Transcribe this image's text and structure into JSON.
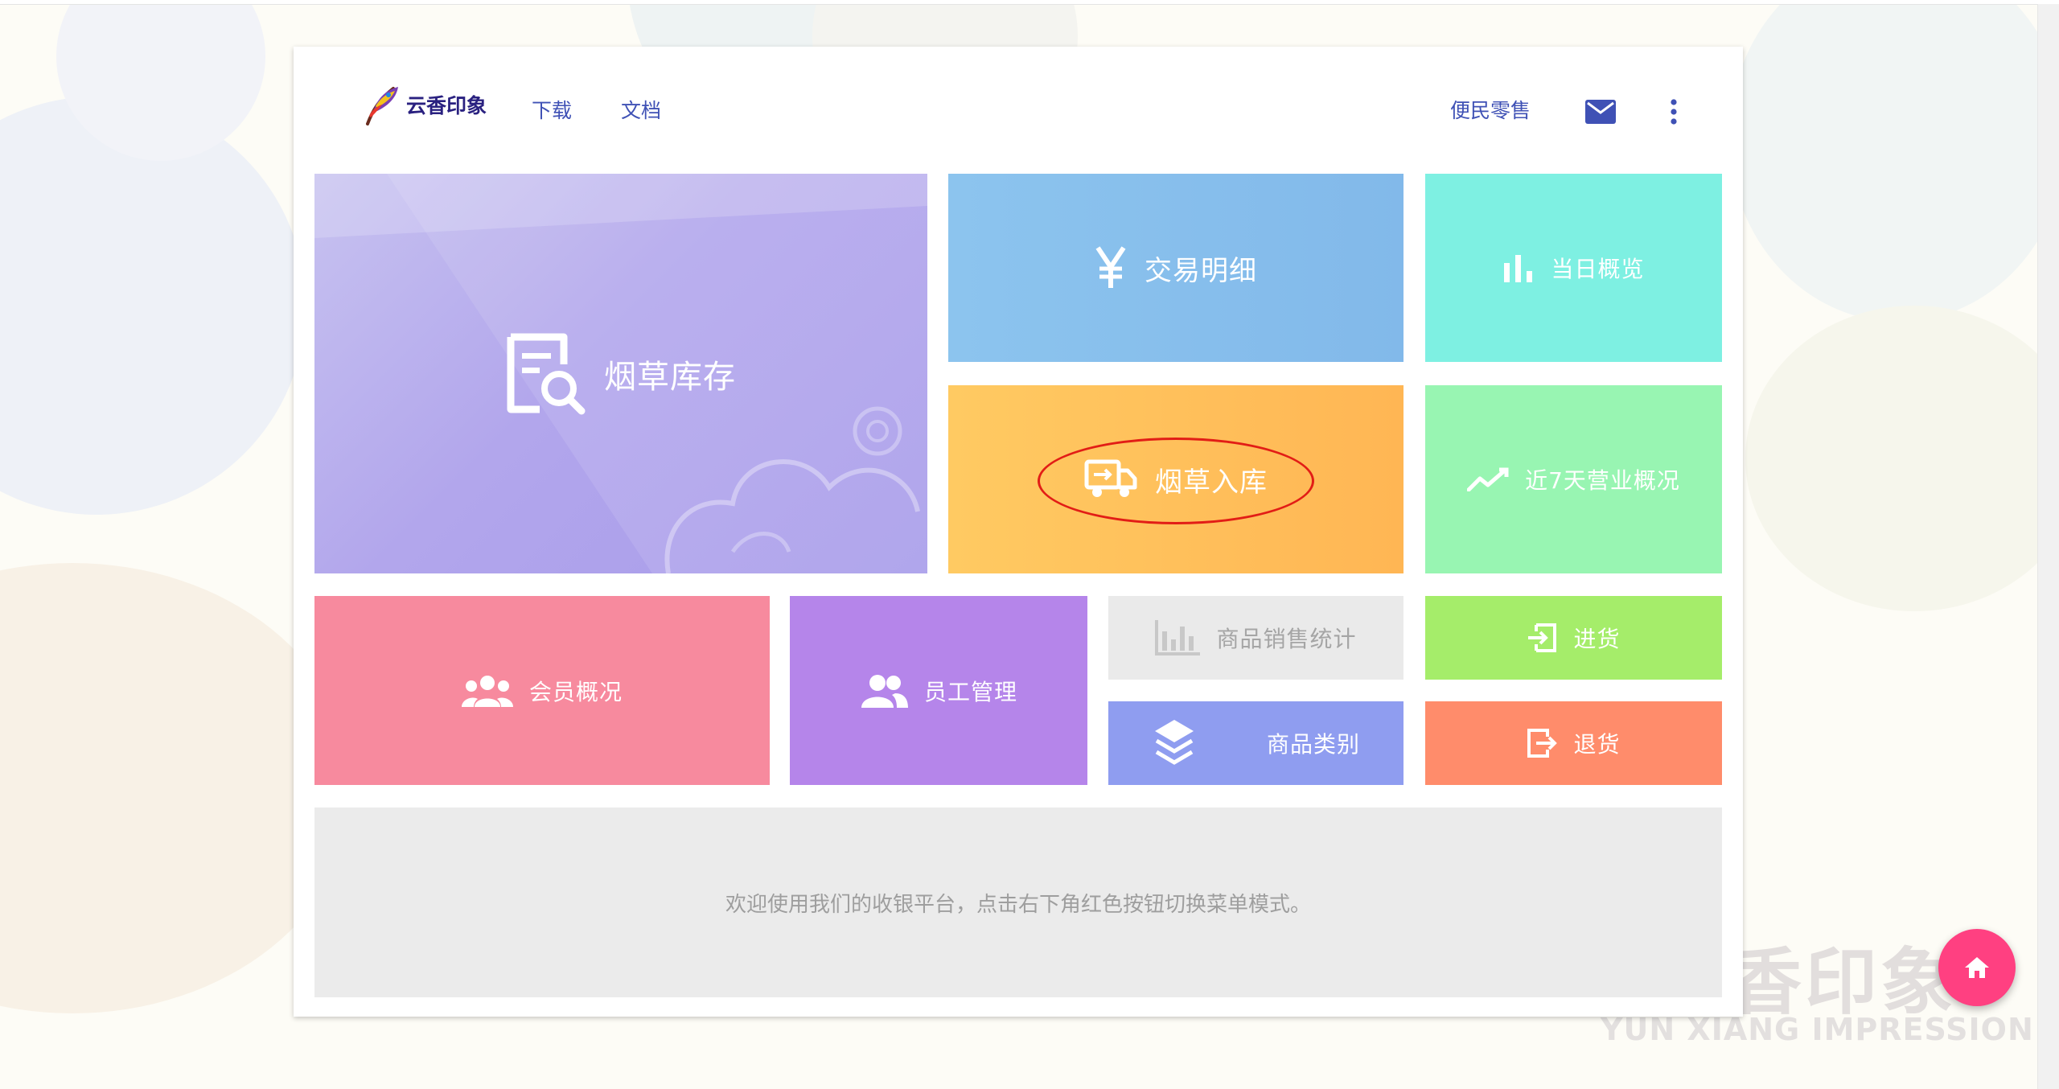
{
  "brand": {
    "name": "云香印象"
  },
  "nav": {
    "download": "下载",
    "docs": "文档",
    "retail": "便民零售"
  },
  "icons": {
    "mail": "mail-icon",
    "more": "more-vert-icon",
    "home": "home-icon"
  },
  "tiles": {
    "inventory": "烟草库存",
    "transactions": "交易明细",
    "today": "当日概览",
    "stock_in": "烟草入库",
    "week": "近7天营业概况",
    "members": "会员概况",
    "staff": "员工管理",
    "sales_stats": "商品销售统计",
    "purchase": "进货",
    "category": "商品类别",
    "return": "退货"
  },
  "welcome": "欢迎使用我们的收银平台，点击右下角红色按钮切换菜单模式。",
  "watermark": {
    "cn": "香印象",
    "en": "YUN XIANG IMPRESSION"
  },
  "colors": {
    "inventory": "#b3a8ec",
    "transactions": "#85bdec",
    "today": "#7ef0e2",
    "stock_in": "#ffbe5a",
    "week": "#98f5b2",
    "members": "#f78a9e",
    "staff": "#b585ea",
    "sales_stats": "#eaeaea",
    "purchase": "#a5ed6a",
    "category": "#8f9df0",
    "return": "#ff8c6b",
    "fab": "#ff4081",
    "link": "#3f51b5"
  }
}
